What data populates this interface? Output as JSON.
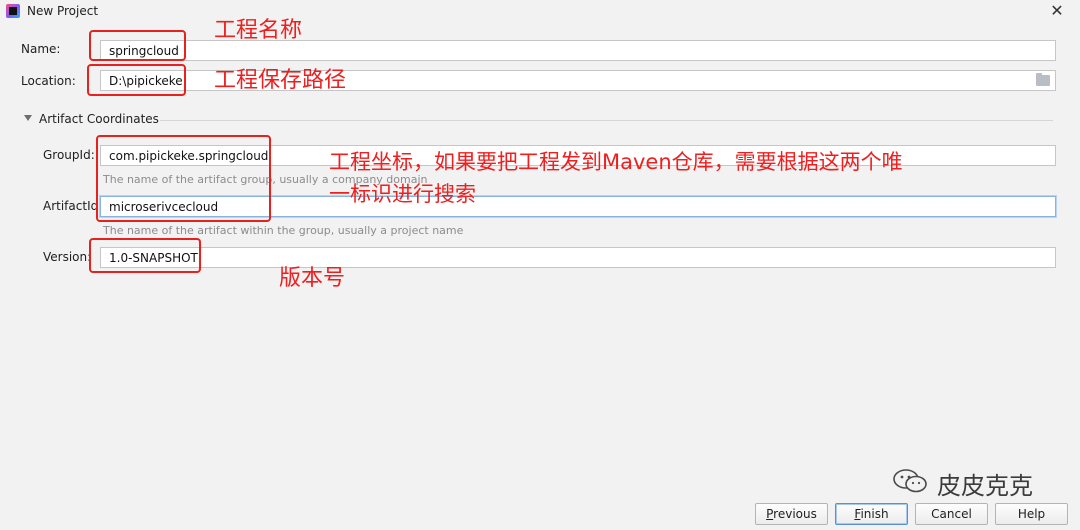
{
  "window": {
    "title": "New Project",
    "close_glyph": "✕"
  },
  "form": {
    "name": {
      "label": "Name:",
      "value": "springcloud"
    },
    "location": {
      "label": "Location:",
      "value": "D:\\pipickeke",
      "browse_icon": "folder-icon"
    },
    "artifact_section": {
      "title": "Artifact Coordinates",
      "expanded": true
    },
    "group_id": {
      "label": "GroupId:",
      "value": "com.pipickeke.springcloud",
      "hint": "The name of the artifact group, usually a company domain"
    },
    "artifact_id": {
      "label": "ArtifactId:",
      "value": "microserivcecloud",
      "hint": "The name of the artifact within the group, usually a project name"
    },
    "version": {
      "label": "Version:",
      "value": "1.0-SNAPSHOT"
    }
  },
  "annotations": {
    "name": "工程名称",
    "location": "工程保存路径",
    "coords_line1": "工程坐标，如果要把工程发到Maven仓库，需要根据这两个唯",
    "coords_line2": "一标识进行搜索",
    "version": "版本号",
    "color": "#ef1f1f"
  },
  "watermark": {
    "text": "皮皮克克",
    "icon": "wechat-icon"
  },
  "buttons": {
    "previous": {
      "mnemonic": "P",
      "rest": "revious"
    },
    "finish": {
      "mnemonic": "F",
      "rest": "inish"
    },
    "cancel": {
      "label": "Cancel"
    },
    "help": {
      "label": "Help"
    }
  }
}
